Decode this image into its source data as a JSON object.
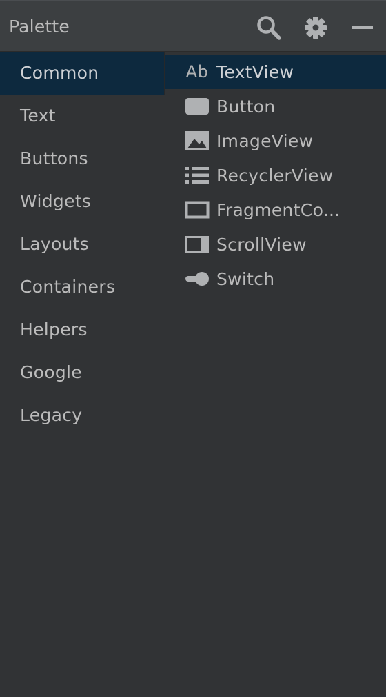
{
  "header": {
    "title": "Palette",
    "search_icon": "search-icon",
    "settings_icon": "gear-icon",
    "minimize_icon": "minimize-icon"
  },
  "categories": [
    {
      "label": "Common",
      "selected": true
    },
    {
      "label": "Text"
    },
    {
      "label": "Buttons"
    },
    {
      "label": "Widgets"
    },
    {
      "label": "Layouts"
    },
    {
      "label": "Containers"
    },
    {
      "label": "Helpers"
    },
    {
      "label": "Google"
    },
    {
      "label": "Legacy"
    }
  ],
  "components": [
    {
      "label": "TextView",
      "icon": "textview-icon",
      "icon_text": "Ab",
      "selected": true
    },
    {
      "label": "Button",
      "icon": "button-icon"
    },
    {
      "label": "ImageView",
      "icon": "image-icon"
    },
    {
      "label": "RecyclerView",
      "icon": "list-icon"
    },
    {
      "label": "FragmentCo...",
      "icon": "fragment-icon"
    },
    {
      "label": "ScrollView",
      "icon": "scrollview-icon"
    },
    {
      "label": "Switch",
      "icon": "switch-icon"
    }
  ],
  "colors": {
    "background": "#313335",
    "header_bg": "#3C3F41",
    "selection": "#0D293E",
    "text": "#BBBBBB",
    "icon": "#AFB1B3"
  }
}
